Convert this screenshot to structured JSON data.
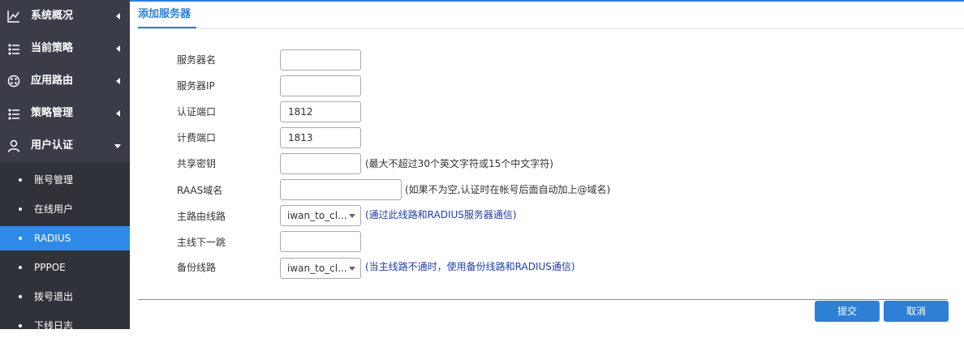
{
  "sidebar": {
    "nav": [
      {
        "label": "系统概况",
        "icon": "chart-line-icon"
      },
      {
        "label": "当前策略",
        "icon": "sliders-icon"
      },
      {
        "label": "应用路由",
        "icon": "route-icon"
      },
      {
        "label": "策略管理",
        "icon": "sliders-icon"
      },
      {
        "label": "用户认证",
        "icon": "user-icon"
      }
    ],
    "sub": [
      {
        "label": "账号管理"
      },
      {
        "label": "在线用户"
      },
      {
        "label": "RADIUS"
      },
      {
        "label": "PPPOE"
      },
      {
        "label": "拨号退出"
      },
      {
        "label": "下线日志"
      }
    ]
  },
  "tab": {
    "title": "添加服务器"
  },
  "form": {
    "server_name": {
      "label": "服务器名",
      "value": ""
    },
    "server_ip": {
      "label": "服务器IP",
      "value": ""
    },
    "auth_port": {
      "label": "认证端口",
      "value": "1812"
    },
    "acct_port": {
      "label": "计费端口",
      "value": "1813"
    },
    "shared_key": {
      "label": "共享密钥",
      "value": "",
      "hint": "(最大不超过30个英文字符或15个中文字符)"
    },
    "raas_domain": {
      "label": "RAAS域名",
      "value": "",
      "hint": "(如果不为空,认证时在帐号后面自动加上@域名)"
    },
    "main_route": {
      "label": "主路由线路",
      "value": "iwan_to_cl...",
      "hint": "(通过此线路和RADIUS服务器通信)"
    },
    "next_hop": {
      "label": "主线下一跳",
      "value": ""
    },
    "backup_route": {
      "label": "备份线路",
      "value": "iwan_to_cl...",
      "hint": "(当主线路不通时，使用备份线路和RADIUS通信)"
    }
  },
  "buttons": {
    "submit": "提交",
    "cancel": "取消"
  },
  "colors": {
    "accent": "#2e7fd6",
    "sidebar": "#2f3238",
    "hint_blue": "#1f3fa8"
  }
}
